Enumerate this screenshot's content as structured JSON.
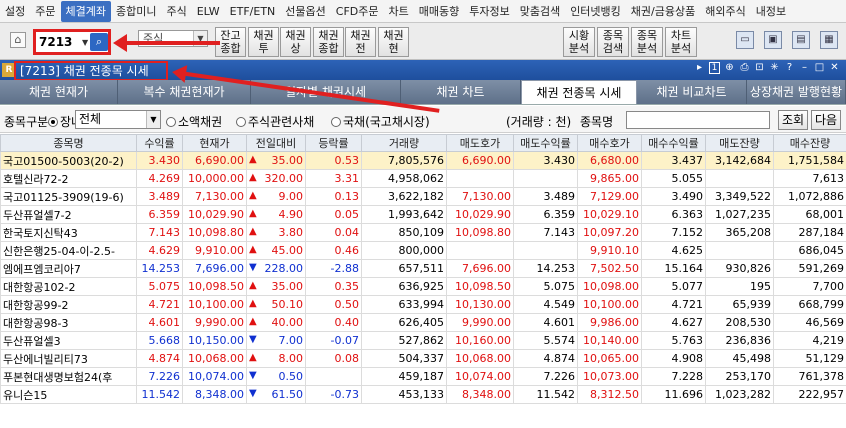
{
  "menu": [
    "설정",
    "주문",
    "체결계좌",
    "종합미니",
    "주식",
    "ELW",
    "ETF/ETN",
    "선물옵션",
    "CFD주문",
    "차트",
    "매매동향",
    "투자정보",
    "맞춤검색",
    "인터넷뱅킹",
    "채권/금융상품",
    "해외주식",
    "내정보"
  ],
  "menu_active": "체결계좌",
  "toolbar": {
    "code_value": "7213",
    "combo_label": "주식",
    "buttons": [
      "잔고\n종합",
      "채권\n투",
      "채권\n상",
      "채권\n종합",
      "채권\n전",
      "채권\n현"
    ],
    "right_buttons": [
      "시황\n분석",
      "종목\n검색",
      "종목\n분석",
      "차트\n분석"
    ]
  },
  "window": {
    "title": "[7213] 채권 전종목 시세",
    "page_num": "1"
  },
  "tabs": [
    "채권 현재가",
    "복수 채권현재가",
    "일자별 채권시세",
    "채권 차트",
    "채권 전종목 시세",
    "채권 비교차트",
    "상장채권 발행현황"
  ],
  "active_tab": "채권 전종목 시세",
  "filter": {
    "label": "종목구분",
    "radio_listed": "장내",
    "select_value": "전체",
    "radio_small": "소액채권",
    "radio_equity": "주식관련사채",
    "radio_gov": "국채(국고채시장)",
    "volume_unit": "(거래량 : 천)",
    "name_label": "종목명",
    "search_btn": "조회",
    "next_btn": "다음"
  },
  "table": {
    "headers": [
      "종목명",
      "수익률",
      "현재가",
      "전일대비",
      "등락률",
      "거래량",
      "매도호가",
      "매도수익률",
      "매수호가",
      "매수수익률",
      "매도잔량",
      "매수잔량"
    ],
    "rows": [
      {
        "name": "국고01500-5003(20-2)",
        "yield": "3.430",
        "price": "6,690.00",
        "dir": "up",
        "change": "35.00",
        "rate": "0.53",
        "vol": "7,805,576",
        "ask": "6,690.00",
        "ask_y": "3.430",
        "bid": "6,680.00",
        "bid_y": "3.437",
        "ask_q": "3,142,684",
        "bid_q": "1,751,584"
      },
      {
        "name": "호텔신라72-2",
        "yield": "4.269",
        "price": "10,000.00",
        "dir": "up",
        "change": "320.00",
        "rate": "3.31",
        "vol": "4,958,062",
        "ask": "",
        "ask_y": "",
        "bid": "9,865.00",
        "bid_y": "5.055",
        "ask_q": "",
        "bid_q": "7,613"
      },
      {
        "name": "국고01125-3909(19-6)",
        "yield": "3.489",
        "price": "7,130.00",
        "dir": "up",
        "change": "9.00",
        "rate": "0.13",
        "vol": "3,622,182",
        "ask": "7,130.00",
        "ask_y": "3.489",
        "bid": "7,129.00",
        "bid_y": "3.490",
        "ask_q": "3,349,522",
        "bid_q": "1,072,886"
      },
      {
        "name": "두산퓨얼셀7-2",
        "yield": "6.359",
        "price": "10,029.90",
        "dir": "up",
        "change": "4.90",
        "rate": "0.05",
        "vol": "1,993,642",
        "ask": "10,029.90",
        "ask_y": "6.359",
        "bid": "10,029.10",
        "bid_y": "6.363",
        "ask_q": "1,027,235",
        "bid_q": "68,001"
      },
      {
        "name": "한국토지신탁43",
        "yield": "7.143",
        "price": "10,098.80",
        "dir": "up",
        "change": "3.80",
        "rate": "0.04",
        "vol": "850,109",
        "ask": "10,098.80",
        "ask_y": "7.143",
        "bid": "10,097.20",
        "bid_y": "7.152",
        "ask_q": "365,208",
        "bid_q": "287,184"
      },
      {
        "name": "신한은행25-04-이-2.5-",
        "yield": "4.629",
        "price": "9,910.00",
        "dir": "up",
        "change": "45.00",
        "rate": "0.46",
        "vol": "800,000",
        "ask": "",
        "ask_y": "",
        "bid": "9,910.10",
        "bid_y": "4.625",
        "ask_q": "",
        "bid_q": "686,045"
      },
      {
        "name": "엠에프엠코리아7",
        "yield": "14.253",
        "price": "7,696.00",
        "dir": "down",
        "change": "228.00",
        "rate": "-2.88",
        "vol": "657,511",
        "ask": "7,696.00",
        "ask_y": "14.253",
        "bid": "7,502.50",
        "bid_y": "15.164",
        "ask_q": "930,826",
        "bid_q": "591,269"
      },
      {
        "name": "대한항공102-2",
        "yield": "5.075",
        "price": "10,098.50",
        "dir": "up",
        "change": "35.00",
        "rate": "0.35",
        "vol": "636,925",
        "ask": "10,098.50",
        "ask_y": "5.075",
        "bid": "10,098.00",
        "bid_y": "5.077",
        "ask_q": "195",
        "bid_q": "7,700"
      },
      {
        "name": "대한항공99-2",
        "yield": "4.721",
        "price": "10,100.00",
        "dir": "up",
        "change": "50.10",
        "rate": "0.50",
        "vol": "633,994",
        "ask": "10,130.00",
        "ask_y": "4.549",
        "bid": "10,100.00",
        "bid_y": "4.721",
        "ask_q": "65,939",
        "bid_q": "668,799"
      },
      {
        "name": "대한항공98-3",
        "yield": "4.601",
        "price": "9,990.00",
        "dir": "up",
        "change": "40.00",
        "rate": "0.40",
        "vol": "626,405",
        "ask": "9,990.00",
        "ask_y": "4.601",
        "bid": "9,986.00",
        "bid_y": "4.627",
        "ask_q": "208,530",
        "bid_q": "46,569"
      },
      {
        "name": "두산퓨얼셀3",
        "yield": "5.668",
        "price": "10,150.00",
        "dir": "down",
        "change": "7.00",
        "rate": "-0.07",
        "vol": "527,862",
        "ask": "10,160.00",
        "ask_y": "5.574",
        "bid": "10,140.00",
        "bid_y": "5.763",
        "ask_q": "236,836",
        "bid_q": "4,219"
      },
      {
        "name": "두산에너빌리티73",
        "yield": "4.874",
        "price": "10,068.00",
        "dir": "up",
        "change": "8.00",
        "rate": "0.08",
        "vol": "504,337",
        "ask": "10,068.00",
        "ask_y": "4.874",
        "bid": "10,065.00",
        "bid_y": "4.908",
        "ask_q": "45,498",
        "bid_q": "51,129"
      },
      {
        "name": "푸본현대생명보험24(후",
        "yield": "7.226",
        "price": "10,074.00",
        "dir": "down",
        "change": "0.50",
        "rate": "",
        "vol": "459,187",
        "ask": "10,074.00",
        "ask_y": "7.226",
        "bid": "10,073.00",
        "bid_y": "7.228",
        "ask_q": "253,170",
        "bid_q": "761,378"
      },
      {
        "name": "유니슨15",
        "yield": "11.542",
        "price": "8,348.00",
        "dir": "down",
        "change": "61.50",
        "rate": "-0.73",
        "vol": "453,133",
        "ask": "8,348.00",
        "ask_y": "11.542",
        "bid": "8,312.50",
        "bid_y": "11.696",
        "ask_q": "1,023,282",
        "bid_q": "222,957"
      }
    ]
  }
}
